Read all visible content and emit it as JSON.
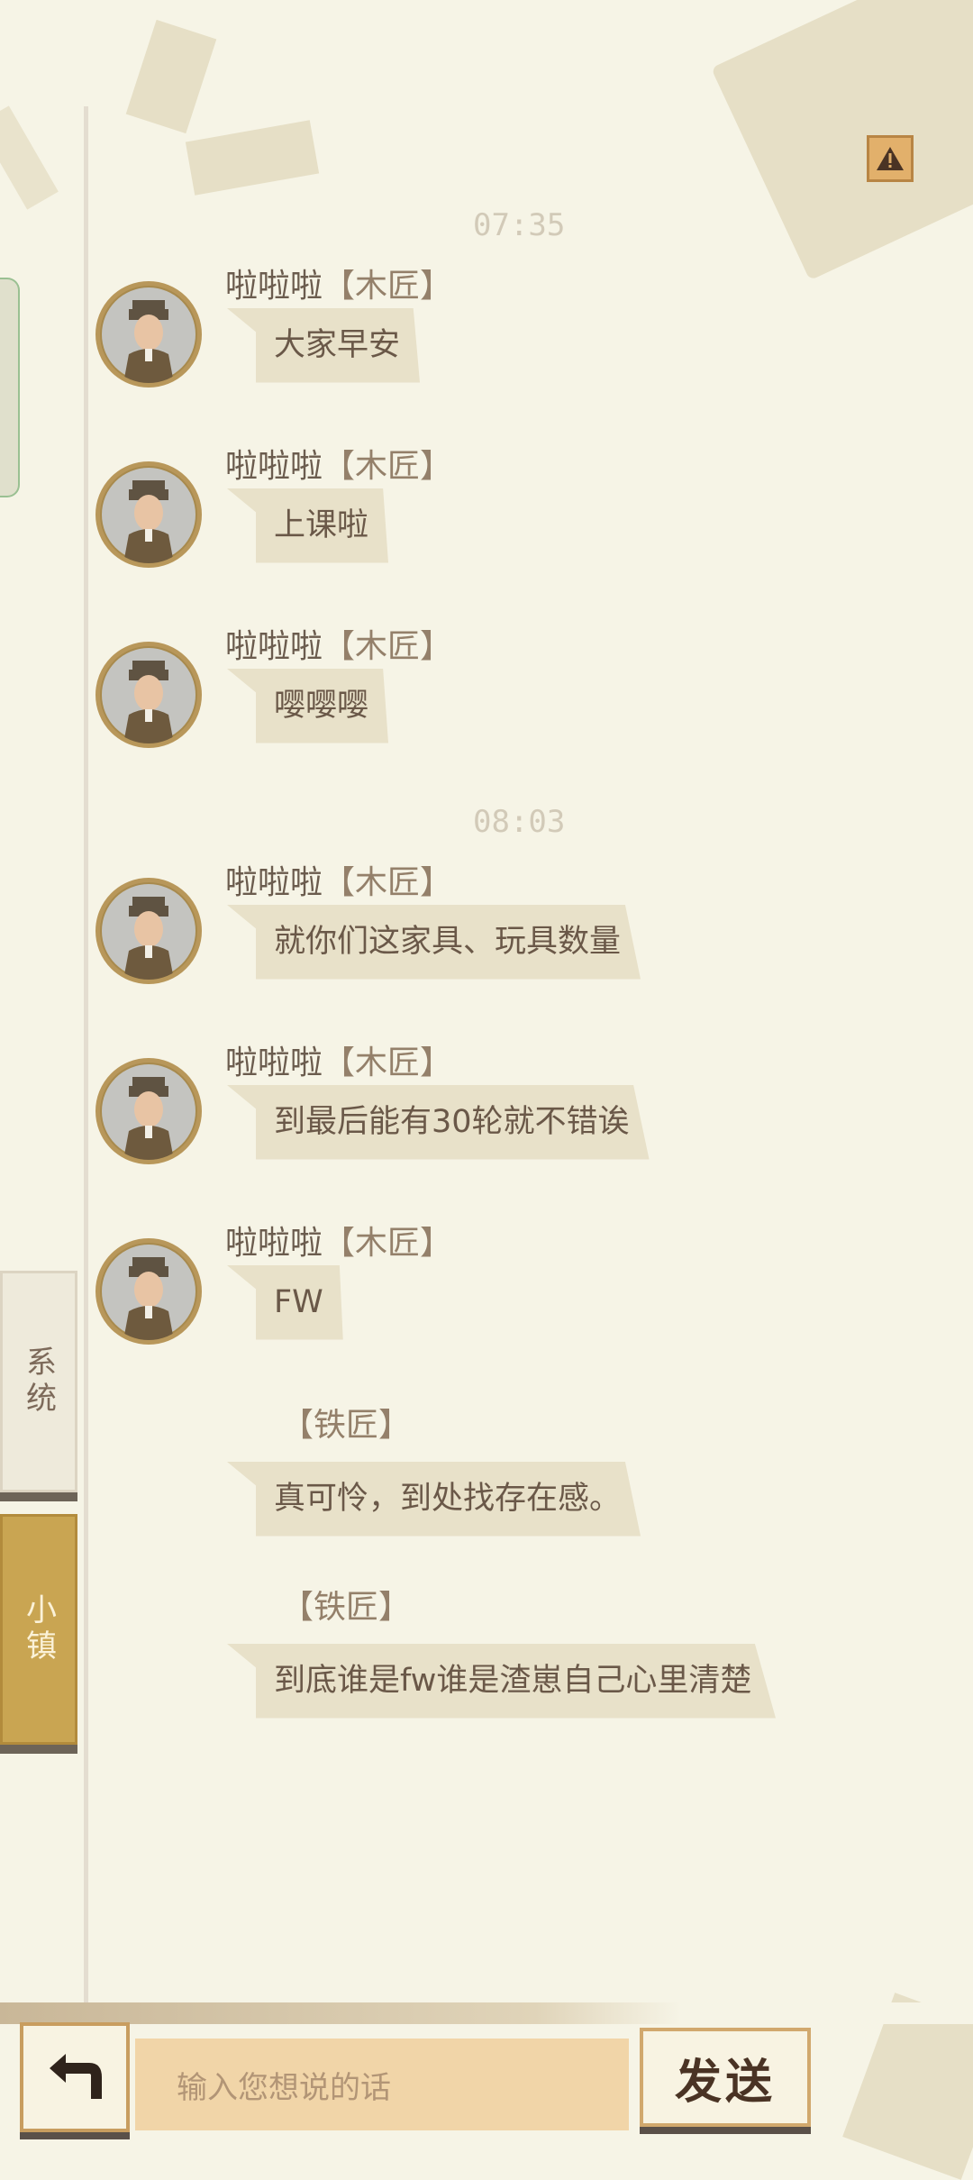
{
  "top": {
    "warning_icon": "warning-triangle-icon"
  },
  "side_tabs": {
    "system": "系统",
    "town": "小镇"
  },
  "timestamps": [
    "07:35",
    "08:03"
  ],
  "messages": [
    {
      "sender": "啦啦啦",
      "role": "【木匠】",
      "text": "大家早安",
      "avatar": "soldier-avatar"
    },
    {
      "sender": "啦啦啦",
      "role": "【木匠】",
      "text": "上课啦",
      "avatar": "soldier-avatar"
    },
    {
      "sender": "啦啦啦",
      "role": "【木匠】",
      "text": "嘤嘤嘤",
      "avatar": "soldier-avatar"
    },
    {
      "sender": "啦啦啦",
      "role": "【木匠】",
      "text": "就你们这家具、玩具数量",
      "avatar": "soldier-avatar"
    },
    {
      "sender": "啦啦啦",
      "role": "【木匠】",
      "text": "到最后能有30轮就不错诶",
      "avatar": "soldier-avatar"
    },
    {
      "sender": "啦啦啦",
      "role": "【木匠】",
      "text": "FW",
      "avatar": "soldier-avatar"
    },
    {
      "sender": "",
      "role": "【铁匠】",
      "text": "真可怜，到处找存在感。"
    },
    {
      "sender": "",
      "role": "【铁匠】",
      "text": "到底谁是fw谁是渣崽自己心里清楚"
    }
  ],
  "input": {
    "placeholder": "输入您想说的话"
  },
  "buttons": {
    "send": "发送",
    "back_icon": "back-arrow-icon"
  }
}
